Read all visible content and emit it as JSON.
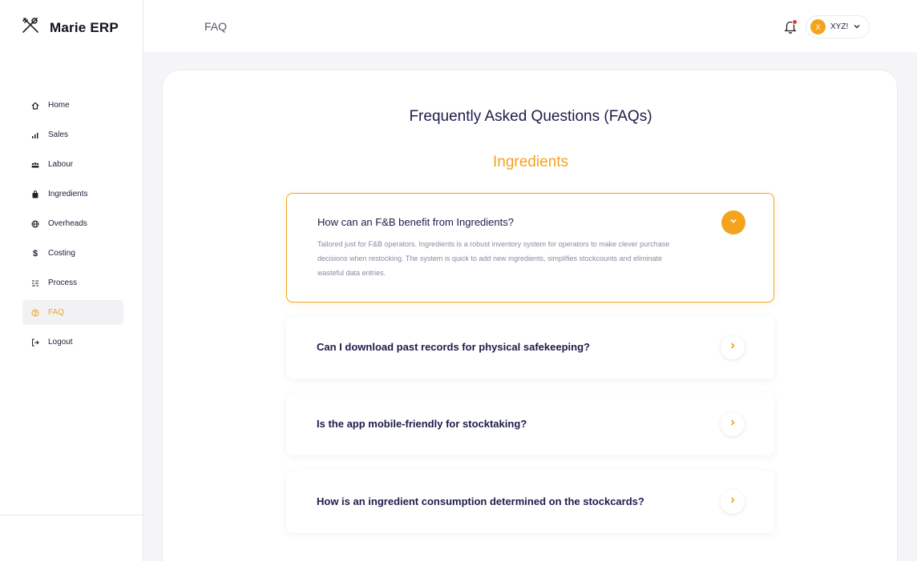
{
  "brand": {
    "name": "Marie ERP"
  },
  "sidebar": {
    "items": [
      {
        "label": "Home",
        "icon": "home-icon"
      },
      {
        "label": "Sales",
        "icon": "chart-icon"
      },
      {
        "label": "Labour",
        "icon": "users-icon"
      },
      {
        "label": "Ingredients",
        "icon": "bag-icon"
      },
      {
        "label": "Overheads",
        "icon": "globe-icon"
      },
      {
        "label": "Costing",
        "icon": "dollar-icon"
      },
      {
        "label": "Process",
        "icon": "list-icon"
      },
      {
        "label": "FAQ",
        "icon": "help-circle-icon",
        "active": true
      },
      {
        "label": "Logout",
        "icon": "logout-icon"
      }
    ]
  },
  "header": {
    "title": "FAQ",
    "user": {
      "initial": "X",
      "name": "XYZ!"
    }
  },
  "main": {
    "heading": "Frequently Asked Questions (FAQs)",
    "section": "Ingredients",
    "faqs": [
      {
        "question": "How can an F&B benefit from Ingredients?",
        "answer": "Tailored just for F&B operators. Ingredients is a robust inventory system for operators to make clever purchase decisions when restocking. The system is quick to add new ingredients, simplifies stockcounts and eliminate wasteful data entries.",
        "expanded": true
      },
      {
        "question": "Can I download past records for physical safekeeping?",
        "expanded": false
      },
      {
        "question": "Is the app mobile-friendly for stocktaking?",
        "expanded": false
      },
      {
        "question": "How is an ingredient consumption determined on the stockcards?",
        "expanded": false
      }
    ]
  },
  "colors": {
    "accent": "#f4a31d",
    "heading": "#1c1c4a",
    "alert": "#e53935"
  }
}
